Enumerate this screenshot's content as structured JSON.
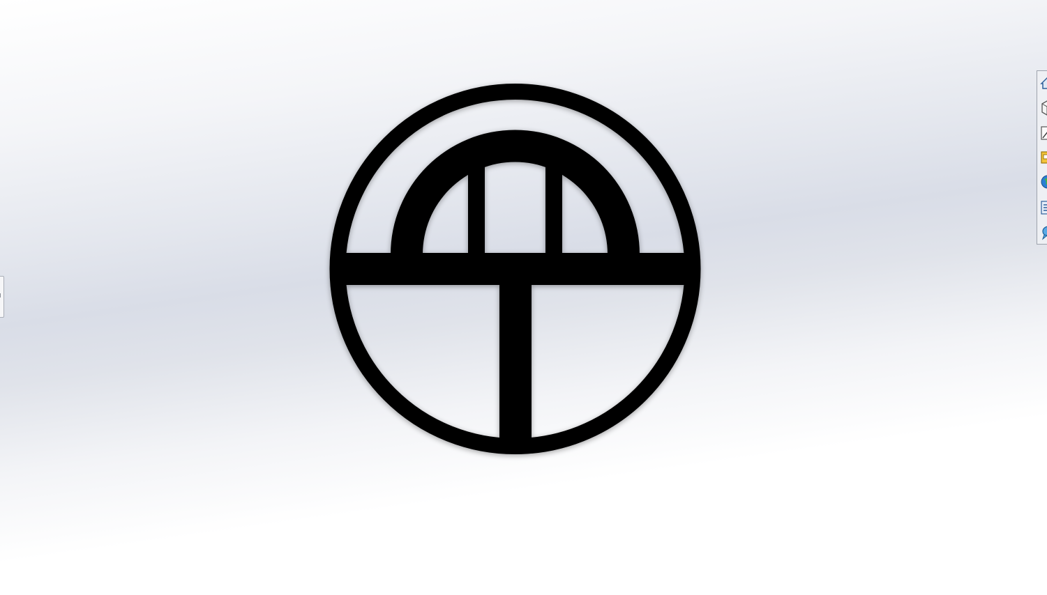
{
  "viewport": {
    "background_top": "#ffffff",
    "background_band": "#d9dde7",
    "model_color": "#000000"
  },
  "model": {
    "description_icon": "emblem-circle-with-arch-and-t"
  },
  "left_panel_tab": {
    "icon": "panel-expand-handle"
  },
  "task_pane": {
    "buttons": [
      {
        "icon": "home-icon"
      },
      {
        "icon": "part-icon"
      },
      {
        "icon": "sketch-icon"
      },
      {
        "icon": "folder-icon"
      },
      {
        "icon": "globe-icon"
      },
      {
        "icon": "list-icon"
      },
      {
        "icon": "forum-icon"
      }
    ]
  }
}
